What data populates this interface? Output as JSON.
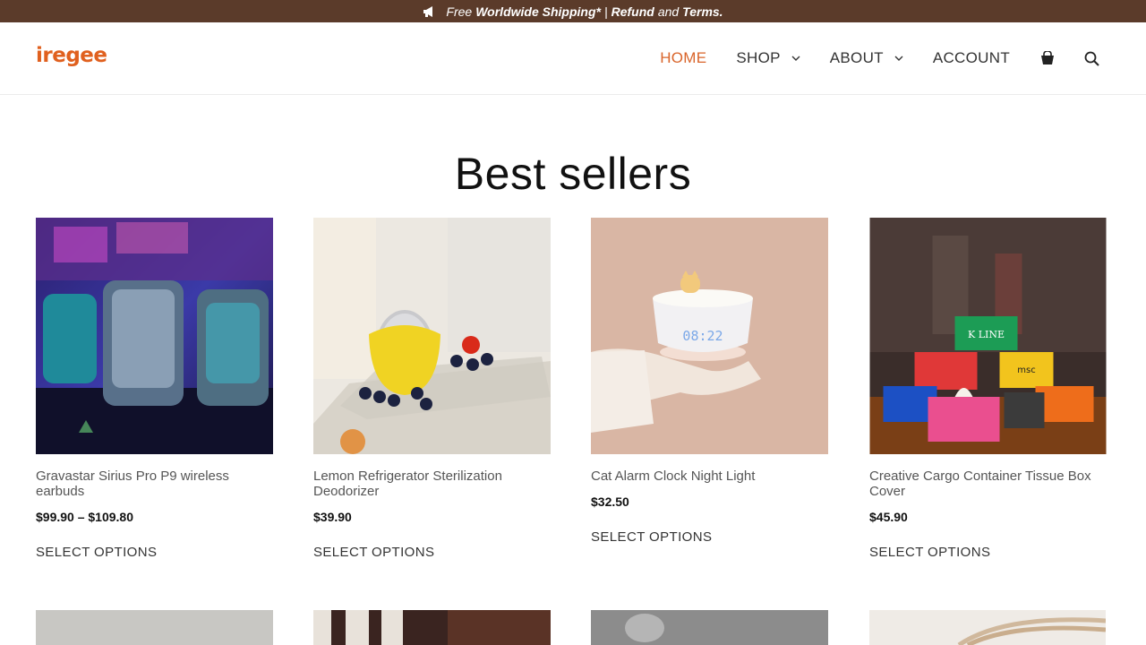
{
  "announcement": {
    "pre": "Free",
    "shipping": "Worldwide Shipping*",
    "sep": "|",
    "refund": "Refund",
    "and": "and",
    "terms": "Terms."
  },
  "brand": {
    "logo_text": "iregee",
    "accent_color": "#e0601e",
    "topbar_color": "#5b3b2a"
  },
  "nav": {
    "home": "HOME",
    "shop": "SHOP",
    "about": "ABOUT",
    "account": "ACCOUNT",
    "cart_icon": "shopping-bag-icon",
    "search_icon": "search-icon"
  },
  "section": {
    "title": "Best sellers"
  },
  "products": [
    {
      "name": "Gravastar Sirius Pro P9 wireless earbuds",
      "price": "$99.90 – $109.80",
      "button": "SELECT OPTIONS"
    },
    {
      "name": "Lemon Refrigerator Sterilization Deodorizer",
      "price": "$39.90",
      "button": "SELECT OPTIONS"
    },
    {
      "name": "Cat Alarm Clock Night Light",
      "price": "$32.50",
      "button": "SELECT OPTIONS"
    },
    {
      "name": "Creative Cargo Container Tissue Box Cover",
      "price": "$45.90",
      "button": "SELECT OPTIONS"
    }
  ],
  "product_images": {
    "p1": {
      "clock": ""
    },
    "p3": {
      "clock": "08:22"
    },
    "p4": {
      "sign_kline": "K LINE",
      "sign_msc": "msc"
    }
  }
}
